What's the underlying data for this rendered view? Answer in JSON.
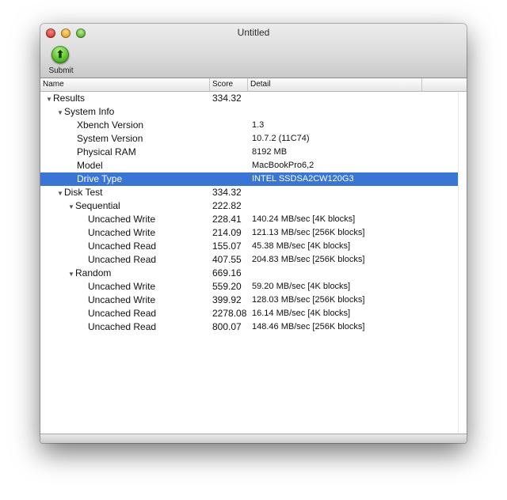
{
  "window": {
    "title": "Untitled"
  },
  "toolbar": {
    "submit_label": "Submit"
  },
  "columns": {
    "name": "Name",
    "score": "Score",
    "detail": "Detail"
  },
  "colors": {
    "selection": "#3875d7",
    "close": "#d9352b",
    "minimize": "#e0a21c",
    "zoom": "#58b02f"
  },
  "rows": [
    {
      "name": "Results",
      "score": "334.32",
      "detail": "",
      "level": 0,
      "disclosure": true
    },
    {
      "name": "System Info",
      "score": "",
      "detail": "",
      "level": 1,
      "disclosure": true
    },
    {
      "name": "Xbench Version",
      "score": "",
      "detail": "1.3",
      "level": 3
    },
    {
      "name": "System Version",
      "score": "",
      "detail": "10.7.2 (11C74)",
      "level": 3
    },
    {
      "name": "Physical RAM",
      "score": "",
      "detail": "8192 MB",
      "level": 3
    },
    {
      "name": "Model",
      "score": "",
      "detail": "MacBookPro6,2",
      "level": 3
    },
    {
      "name": "Drive Type",
      "score": "",
      "detail": "INTEL SSDSA2CW120G3",
      "level": 3,
      "selected": true
    },
    {
      "name": "Disk Test",
      "score": "334.32",
      "detail": "",
      "level": 1,
      "disclosure": true
    },
    {
      "name": "Sequential",
      "score": "222.82",
      "detail": "",
      "level": 2,
      "disclosure": true
    },
    {
      "name": "Uncached Write",
      "score": "228.41",
      "detail": "140.24 MB/sec [4K blocks]",
      "level": 4
    },
    {
      "name": "Uncached Write",
      "score": "214.09",
      "detail": "121.13 MB/sec [256K blocks]",
      "level": 4
    },
    {
      "name": "Uncached Read",
      "score": "155.07",
      "detail": "45.38 MB/sec [4K blocks]",
      "level": 4
    },
    {
      "name": "Uncached Read",
      "score": "407.55",
      "detail": "204.83 MB/sec [256K blocks]",
      "level": 4
    },
    {
      "name": "Random",
      "score": "669.16",
      "detail": "",
      "level": 2,
      "disclosure": true
    },
    {
      "name": "Uncached Write",
      "score": "559.20",
      "detail": "59.20 MB/sec [4K blocks]",
      "level": 4
    },
    {
      "name": "Uncached Write",
      "score": "399.92",
      "detail": "128.03 MB/sec [256K blocks]",
      "level": 4
    },
    {
      "name": "Uncached Read",
      "score": "2278.08",
      "detail": "16.14 MB/sec [4K blocks]",
      "level": 4
    },
    {
      "name": "Uncached Read",
      "score": "800.07",
      "detail": "148.46 MB/sec [256K blocks]",
      "level": 4
    }
  ]
}
